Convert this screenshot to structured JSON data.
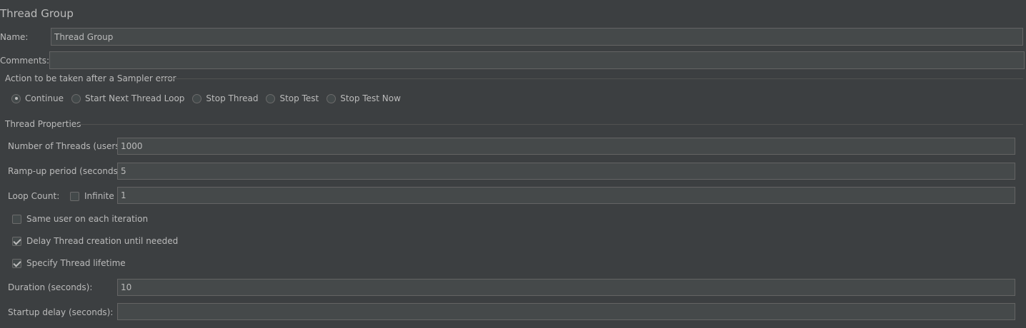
{
  "panel": {
    "title": "Thread Group",
    "name_label": "Name:",
    "name_value": "Thread Group",
    "comments_label": "Comments:",
    "comments_value": ""
  },
  "sampler_error": {
    "title": "Action to be taken after a Sampler error",
    "options": [
      {
        "label": "Continue",
        "selected": true
      },
      {
        "label": "Start Next Thread Loop",
        "selected": false
      },
      {
        "label": "Stop Thread",
        "selected": false
      },
      {
        "label": "Stop Test",
        "selected": false
      },
      {
        "label": "Stop Test Now",
        "selected": false
      }
    ]
  },
  "thread_properties": {
    "title": "Thread Properties",
    "num_threads_label": "Number of Threads (users):",
    "num_threads_value": "1000",
    "ramp_up_label": "Ramp-up period (seconds):",
    "ramp_up_value": "5",
    "loop_count_label": "Loop Count:",
    "infinite_label": "Infinite",
    "infinite_checked": false,
    "loop_count_value": "1",
    "same_user_label": "Same user on each iteration",
    "same_user_checked": false,
    "delay_creation_label": "Delay Thread creation until needed",
    "delay_creation_checked": true,
    "specify_lifetime_label": "Specify Thread lifetime",
    "specify_lifetime_checked": true,
    "duration_label": "Duration (seconds):",
    "duration_value": "10",
    "startup_delay_label": "Startup delay (seconds):",
    "startup_delay_value": ""
  }
}
